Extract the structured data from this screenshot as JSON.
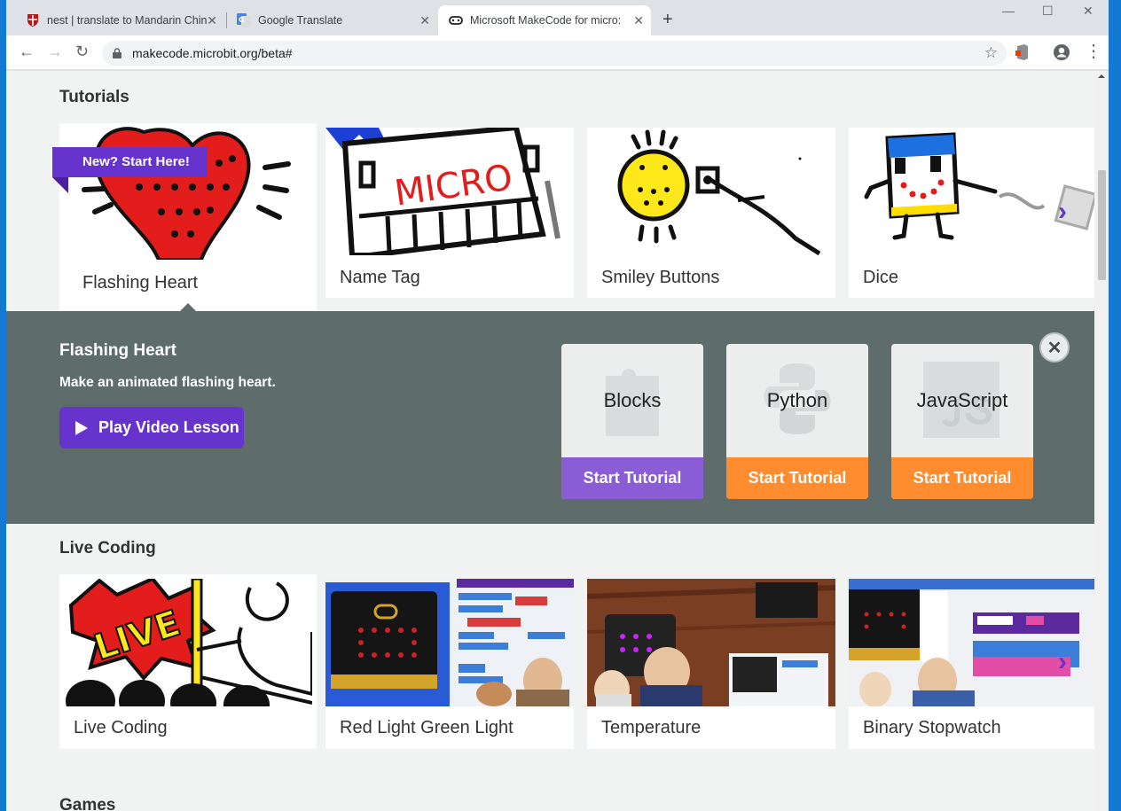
{
  "browser": {
    "tabs": [
      {
        "title": "nest | translate to Mandarin Chin",
        "active": false
      },
      {
        "title": "Google Translate",
        "active": false
      },
      {
        "title": "Microsoft MakeCode for micro:bit",
        "active": true
      }
    ],
    "close_glyph": "✕",
    "new_tab_glyph": "+",
    "window_controls": [
      "—",
      "☐",
      "✕"
    ],
    "url": "makecode.microbit.org/beta#",
    "back_glyph": "←",
    "forward_glyph": "→",
    "reload_glyph": "↻",
    "star_glyph": "☆",
    "menu_glyph": "⋮"
  },
  "tutorials": {
    "section_title": "Tutorials",
    "ribbon": "New? Start Here!",
    "cards": [
      {
        "label": "Flashing Heart",
        "icon": "heart-illustration"
      },
      {
        "label": "Name Tag",
        "icon": "micro-name-tag-illustration"
      },
      {
        "label": "Smiley Buttons",
        "icon": "smiley-button-illustration"
      },
      {
        "label": "Dice",
        "icon": "dice-illustration"
      }
    ],
    "next_glyph": "›"
  },
  "detail": {
    "title": "Flashing Heart",
    "description": "Make an animated flashing heart.",
    "play_button": "Play Video Lesson",
    "close_glyph": "✕",
    "languages": [
      {
        "name": "Blocks",
        "button": "Start Tutorial",
        "color": "#8a5cd6"
      },
      {
        "name": "Python",
        "button": "Start Tutorial",
        "color": "#ff8c2e"
      },
      {
        "name": "JavaScript",
        "button": "Start Tutorial",
        "color": "#ff8c2e"
      }
    ]
  },
  "live_coding": {
    "section_title": "Live Coding",
    "cards": [
      {
        "label": "Live Coding",
        "icon": "live-illustration"
      },
      {
        "label": "Red Light Green Light",
        "icon": "video-thumbnail"
      },
      {
        "label": "Temperature",
        "icon": "video-thumbnail"
      },
      {
        "label": "Binary Stopwatch",
        "icon": "video-thumbnail"
      }
    ],
    "next_glyph": "›"
  },
  "games": {
    "section_title": "Games"
  },
  "colors": {
    "brand_purple": "#6633cc",
    "orange": "#ff8c2e",
    "panel": "#5e6d6c",
    "page_bg": "#f1f2f2"
  }
}
